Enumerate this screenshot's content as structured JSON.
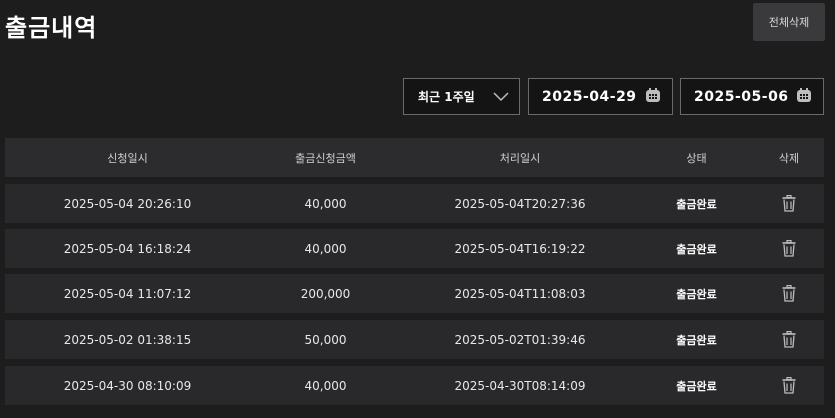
{
  "page": {
    "title": "출금내역",
    "delete_all_label": "전체삭제"
  },
  "filters": {
    "period": "최근 1주일",
    "date_from": "2025-04-29",
    "date_to": "2025-05-06"
  },
  "table": {
    "headers": [
      "신청일시",
      "출금신청금액",
      "처리일시",
      "상태",
      "삭제"
    ],
    "rows": [
      {
        "requested": "2025-05-04 20:26:10",
        "amount": "40,000",
        "processed": "2025-05-04T20:27:36",
        "status": "출금완료"
      },
      {
        "requested": "2025-05-04 16:18:24",
        "amount": "40,000",
        "processed": "2025-05-04T16:19:22",
        "status": "출금완료"
      },
      {
        "requested": "2025-05-04 11:07:12",
        "amount": "200,000",
        "processed": "2025-05-04T11:08:03",
        "status": "출금완료"
      },
      {
        "requested": "2025-05-02 01:38:15",
        "amount": "50,000",
        "processed": "2025-05-02T01:39:46",
        "status": "출금완료"
      },
      {
        "requested": "2025-04-30 08:10:09",
        "amount": "40,000",
        "processed": "2025-04-30T08:14:09",
        "status": "출금완료"
      }
    ]
  },
  "icons": {
    "select": "chevron-down-icon",
    "date": "calendar-icon",
    "row_delete": "trash-icon"
  },
  "colors": {
    "background": "#1d1d1e",
    "row": "#29292b",
    "header": "#2c2c2e",
    "button": "#3a3a3c"
  }
}
